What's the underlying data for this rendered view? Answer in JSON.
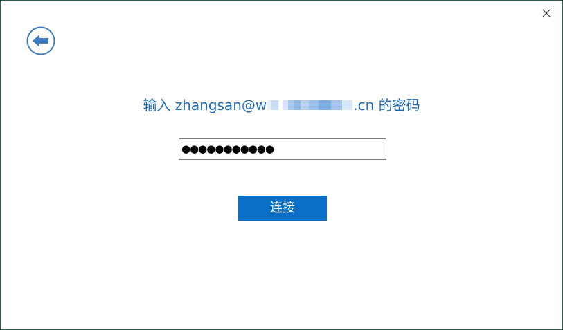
{
  "dialog": {
    "title_prefix": "输入 zhangsan@w",
    "title_suffix": ".cn 的密码",
    "password_mask": "●●●●●●●●●●●",
    "connect_label": "连接"
  },
  "icons": {
    "back": "back-arrow-icon",
    "close": "close-icon"
  },
  "colors": {
    "title": "#1f6ab4",
    "button": "#0a6fc7",
    "back_icon": "#3f7bbf"
  }
}
